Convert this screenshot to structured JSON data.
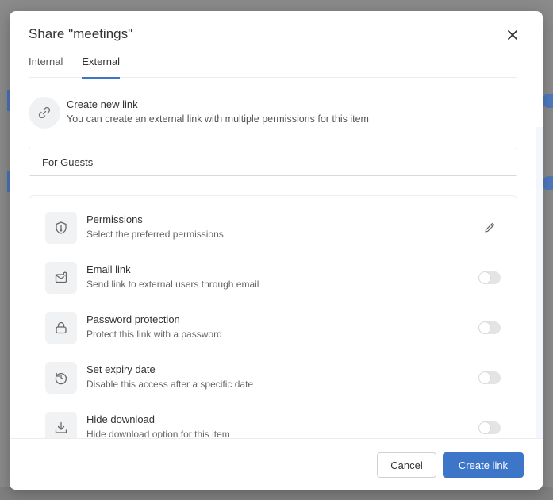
{
  "dialog": {
    "title": "Share \"meetings\"",
    "close_icon": "close-icon"
  },
  "tabs": [
    {
      "label": "Internal",
      "active": false
    },
    {
      "label": "External",
      "active": true
    }
  ],
  "create_link": {
    "icon": "link-icon",
    "title": "Create new link",
    "description": "You can create an external link with multiple permissions for this item"
  },
  "link_name_input": {
    "value": "For Guests"
  },
  "options": [
    {
      "icon": "shield-icon",
      "title": "Permissions",
      "description": "Select the preferred permissions",
      "control": "edit"
    },
    {
      "icon": "email-icon",
      "title": "Email link",
      "description": "Send link to external users through email",
      "control": "toggle",
      "enabled": false
    },
    {
      "icon": "lock-icon",
      "title": "Password protection",
      "description": "Protect this link with a password",
      "control": "toggle",
      "enabled": false
    },
    {
      "icon": "clock-icon",
      "title": "Set expiry date",
      "description": "Disable this access after a specific date",
      "control": "toggle",
      "enabled": false
    },
    {
      "icon": "download-icon",
      "title": "Hide download",
      "description": "Hide download option for this item",
      "control": "toggle",
      "enabled": false
    }
  ],
  "footer": {
    "cancel_label": "Cancel",
    "create_label": "Create link"
  },
  "colors": {
    "accent": "#3d75c9",
    "overlay": "#8a8a8a"
  }
}
